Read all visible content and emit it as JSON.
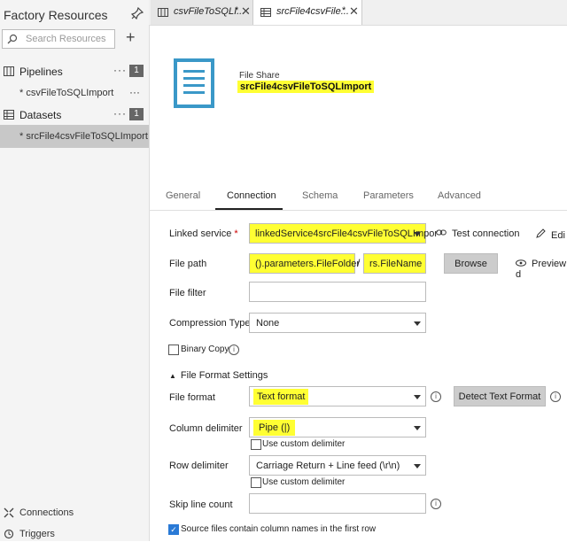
{
  "sidebar": {
    "title": "Factory Resources",
    "search_placeholder": "Search Resources",
    "add_label": "+",
    "pipelines": {
      "label": "Pipelines",
      "more": "···",
      "count": "1"
    },
    "pipeline_items": [
      {
        "label": "* csvFileToSQLImport",
        "more": "···"
      }
    ],
    "datasets": {
      "label": "Datasets",
      "more": "···",
      "count": "1"
    },
    "dataset_items": [
      {
        "label": "* srcFile4csvFileToSQLImport"
      }
    ],
    "footer": {
      "connections": "Connections",
      "triggers": "Triggers"
    }
  },
  "tabs": [
    {
      "label": "csvFileToSQLI...",
      "modified": "*",
      "close": "✕"
    },
    {
      "label": "srcFile4csvFile...",
      "modified": "*",
      "close": "✕"
    }
  ],
  "header": {
    "kind": "File Share",
    "name": "srcFile4csvFileToSQLImport"
  },
  "subtabs": [
    "General",
    "Connection",
    "Schema",
    "Parameters",
    "Advanced"
  ],
  "form": {
    "linked_service": {
      "label": "Linked service",
      "required": "*",
      "value": "linkedService4srcFile4csvFileToSQLImpor",
      "test": "Test connection",
      "edit": "Edi"
    },
    "file_path": {
      "label": "File path",
      "folder": "().parameters.FileFolder",
      "sep": "/",
      "file": "rs.FileName",
      "browse": "Browse",
      "preview": "Preview d"
    },
    "file_filter": {
      "label": "File filter",
      "value": ""
    },
    "compression": {
      "label": "Compression Type",
      "value": "None"
    },
    "binary_copy": {
      "label": "Binary Copy"
    },
    "format_section": "File Format Settings",
    "file_format": {
      "label": "File format",
      "value": "Text format",
      "detect": "Detect Text Format"
    },
    "column_delimiter": {
      "label": "Column delimiter",
      "value": "Pipe (|)",
      "custom": "Use custom delimiter"
    },
    "row_delimiter": {
      "label": "Row delimiter",
      "value": "Carriage Return + Line feed (\\r\\n)",
      "custom": "Use custom delimiter"
    },
    "skip_line": {
      "label": "Skip line count",
      "value": ""
    },
    "header_row": {
      "label": "Source files contain column names in the first row",
      "checked": true
    }
  },
  "colors": {
    "accent": "#3a98c8",
    "highlight": "#ffff33",
    "checkbox": "#2a7ad6"
  }
}
